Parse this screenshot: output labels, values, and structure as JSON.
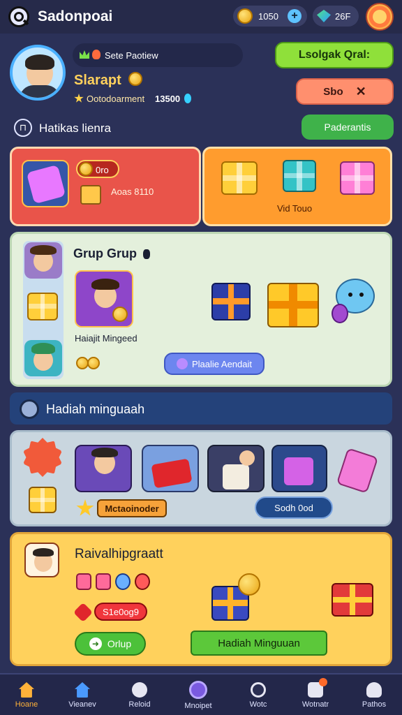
{
  "header": {
    "app_title": "Sadonpoai",
    "coins": "1050",
    "gems": "26F"
  },
  "profile": {
    "status_label": "Sete Paotiew",
    "name": "Slarapt",
    "subtitle": "Ootodoarment",
    "score": "13500",
    "primary_btn": "Lsolgak Qral:",
    "secondary_btn": "Sbo"
  },
  "section_a": {
    "title": "Hatikas lienra",
    "action": "Paderantis"
  },
  "promo": {
    "badge": "0ro",
    "left_text": "Aoas 8110",
    "right_text": "Vid Touo"
  },
  "group": {
    "title": "Grup Grup",
    "feature_caption": "Haiajit Mingeed",
    "action": "Plaalie Aendait"
  },
  "weekly": {
    "title": "Hadiah minguaah"
  },
  "rewards": {
    "tag": "Mctaoinoder",
    "action": "Sodh 0od"
  },
  "bottom_card": {
    "title": "Raivalhipgraatt",
    "price": "S1e0og9",
    "left_btn": "Orlup",
    "right_btn": "Hadiah Minguuan"
  },
  "nav": [
    {
      "label": "Hoane"
    },
    {
      "label": "Vieanev"
    },
    {
      "label": "Reloid"
    },
    {
      "label": "Mnoipet"
    },
    {
      "label": "Wotc"
    },
    {
      "label": "Wotnatr"
    },
    {
      "label": "Pathos"
    }
  ],
  "colors": {
    "bg": "#2b3158",
    "green": "#8fe03a",
    "salmon": "#ff8f6e",
    "red_card": "#e9544a",
    "orange_card": "#ff9c2e",
    "mint_card": "#e4f0dc",
    "yellow_card": "#ffd15c"
  }
}
